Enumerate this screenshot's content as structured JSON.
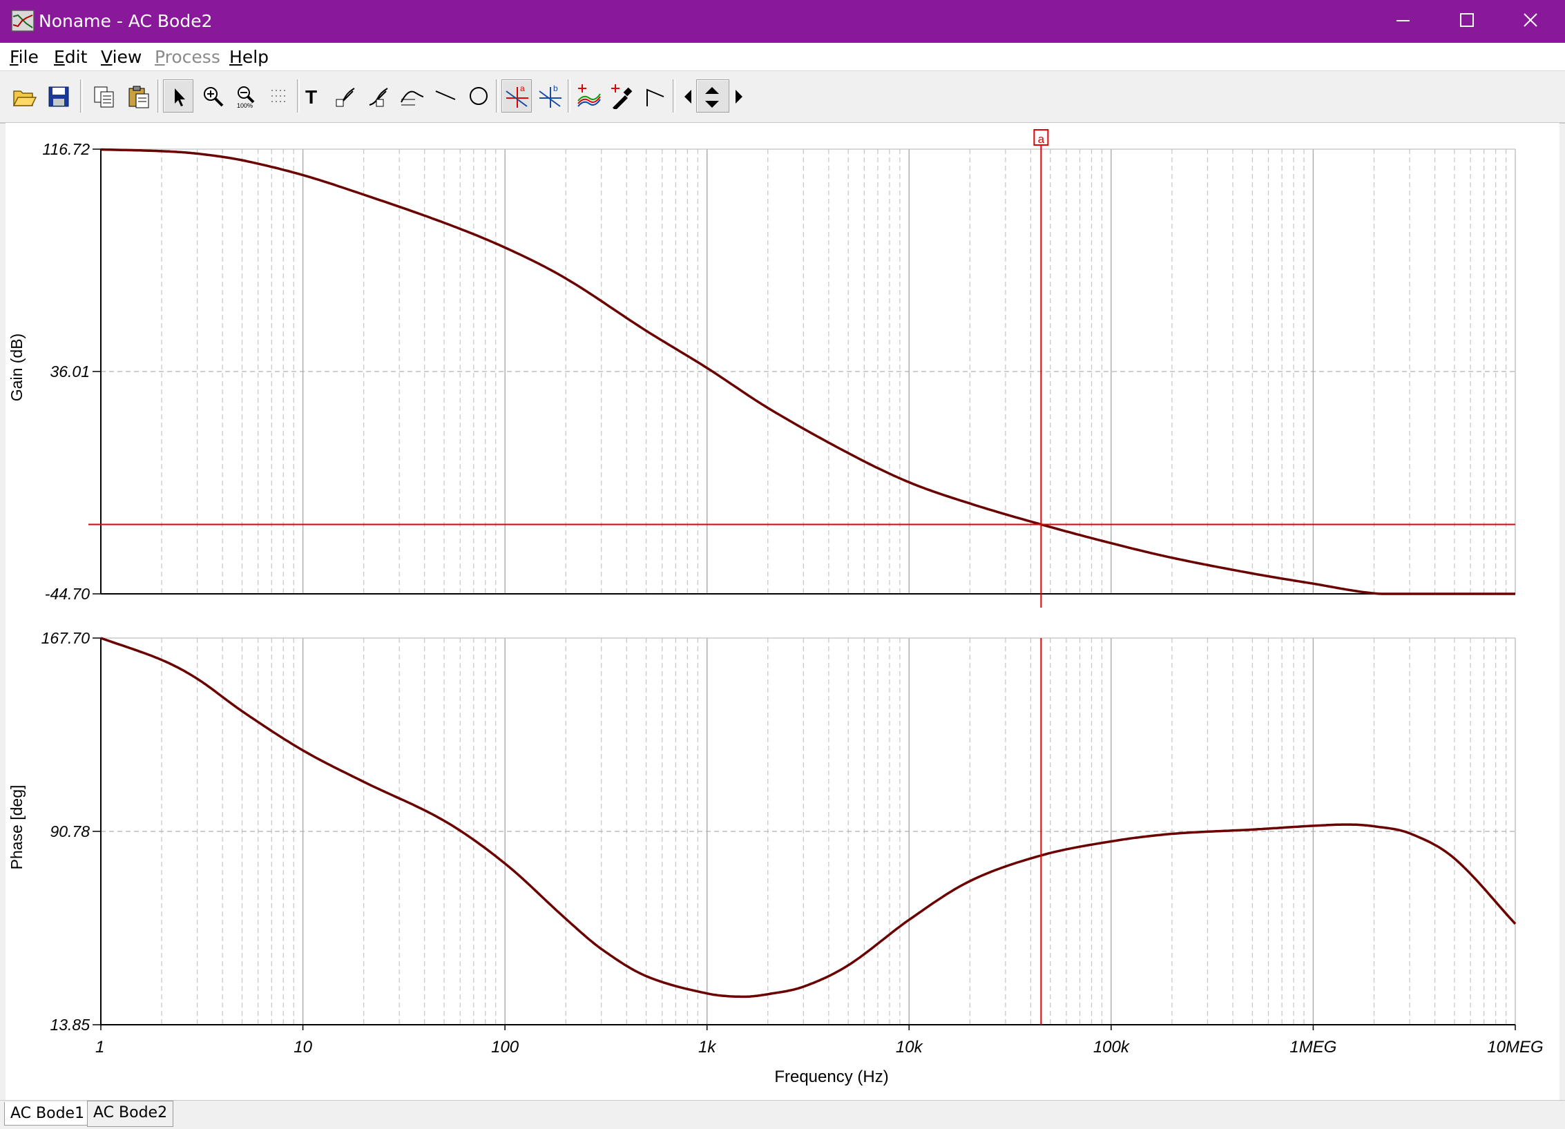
{
  "window": {
    "title": "Noname - AC Bode2",
    "titlebar_color": "#89189a",
    "controls": [
      "minimize",
      "maximize",
      "close"
    ]
  },
  "menu": [
    {
      "label": "File",
      "enabled": true
    },
    {
      "label": "Edit",
      "enabled": true
    },
    {
      "label": "View",
      "enabled": true
    },
    {
      "label": "Process",
      "enabled": false
    },
    {
      "label": "Help",
      "enabled": true
    }
  ],
  "toolbar": [
    "open-icon",
    "save-icon",
    "copy-icon",
    "paste-icon",
    "pointer-icon",
    "zoom-in-icon",
    "zoom-100-icon",
    "grid-icon",
    "text-icon",
    "arrow-x-icon",
    "arrow-y-icon",
    "label-icon",
    "line-icon",
    "circle-icon",
    "cursor-a-icon",
    "cursor-b-icon",
    "add-curve-icon",
    "probe-icon",
    "step-icon",
    "cursor-left-icon",
    "cursor-updown-icon",
    "cursor-right-icon"
  ],
  "chart_data": [
    {
      "type": "line",
      "name": "gain",
      "ylabel": "Gain (dB)",
      "yticks": [
        "116.72",
        "36.01",
        "-44.70"
      ],
      "ylim": [
        -44.7,
        116.72
      ],
      "xscale": "log",
      "xlim": [
        1,
        10000000
      ],
      "grid": true,
      "x": [
        1,
        2,
        3,
        5,
        10,
        20,
        50,
        100,
        200,
        500,
        1000,
        2000,
        5000,
        10000,
        20000,
        45000,
        100000,
        200000,
        500000,
        1000000,
        2000000,
        5000000,
        10000000
      ],
      "y": [
        116.6,
        116.0,
        115.1,
        112.7,
        107.3,
        100.2,
        90.0,
        81.0,
        69.8,
        50.8,
        37.3,
        22.8,
        6.4,
        -4.2,
        -11.9,
        -19.5,
        -26.3,
        -31.6,
        -37.3,
        -41.0,
        -44.5,
        -45.6,
        -44.7
      ],
      "series_color": "#6b0000"
    },
    {
      "type": "line",
      "name": "phase",
      "ylabel": "Phase [deg]",
      "yticks": [
        "167.70",
        "90.78",
        "13.85"
      ],
      "ylim": [
        13.85,
        167.7
      ],
      "xscale": "log",
      "xlim": [
        1,
        10000000
      ],
      "xticks": [
        "1",
        "10",
        "100",
        "1k",
        "10k",
        "100k",
        "1MEG",
        "10MEG"
      ],
      "xlabel": "Frequency (Hz)",
      "grid": true,
      "x": [
        1,
        2,
        3,
        5,
        10,
        20,
        50,
        100,
        200,
        300,
        500,
        1000,
        1500,
        2000,
        3000,
        5000,
        10000,
        20000,
        45000,
        100000,
        200000,
        500000,
        1000000,
        1500000,
        2000000,
        3000000,
        5000000,
        10000000
      ],
      "y": [
        167.7,
        159.0,
        151.5,
        138.6,
        123.0,
        110.5,
        95.0,
        78.0,
        56.0,
        44.0,
        33.2,
        26.3,
        25.0,
        26.0,
        29.0,
        37.5,
        55.6,
        71.0,
        81.2,
        86.8,
        89.8,
        91.5,
        93.0,
        93.5,
        92.8,
        90.0,
        80.0,
        54.0
      ],
      "series_color": "#6b0000"
    }
  ],
  "cursor": {
    "label": "a",
    "frequency": 45000,
    "gain_value": -19.5,
    "color": "#e00000"
  },
  "tabs": [
    {
      "label": "AC Bode1",
      "active": false
    },
    {
      "label": "AC Bode2",
      "active": true
    }
  ]
}
